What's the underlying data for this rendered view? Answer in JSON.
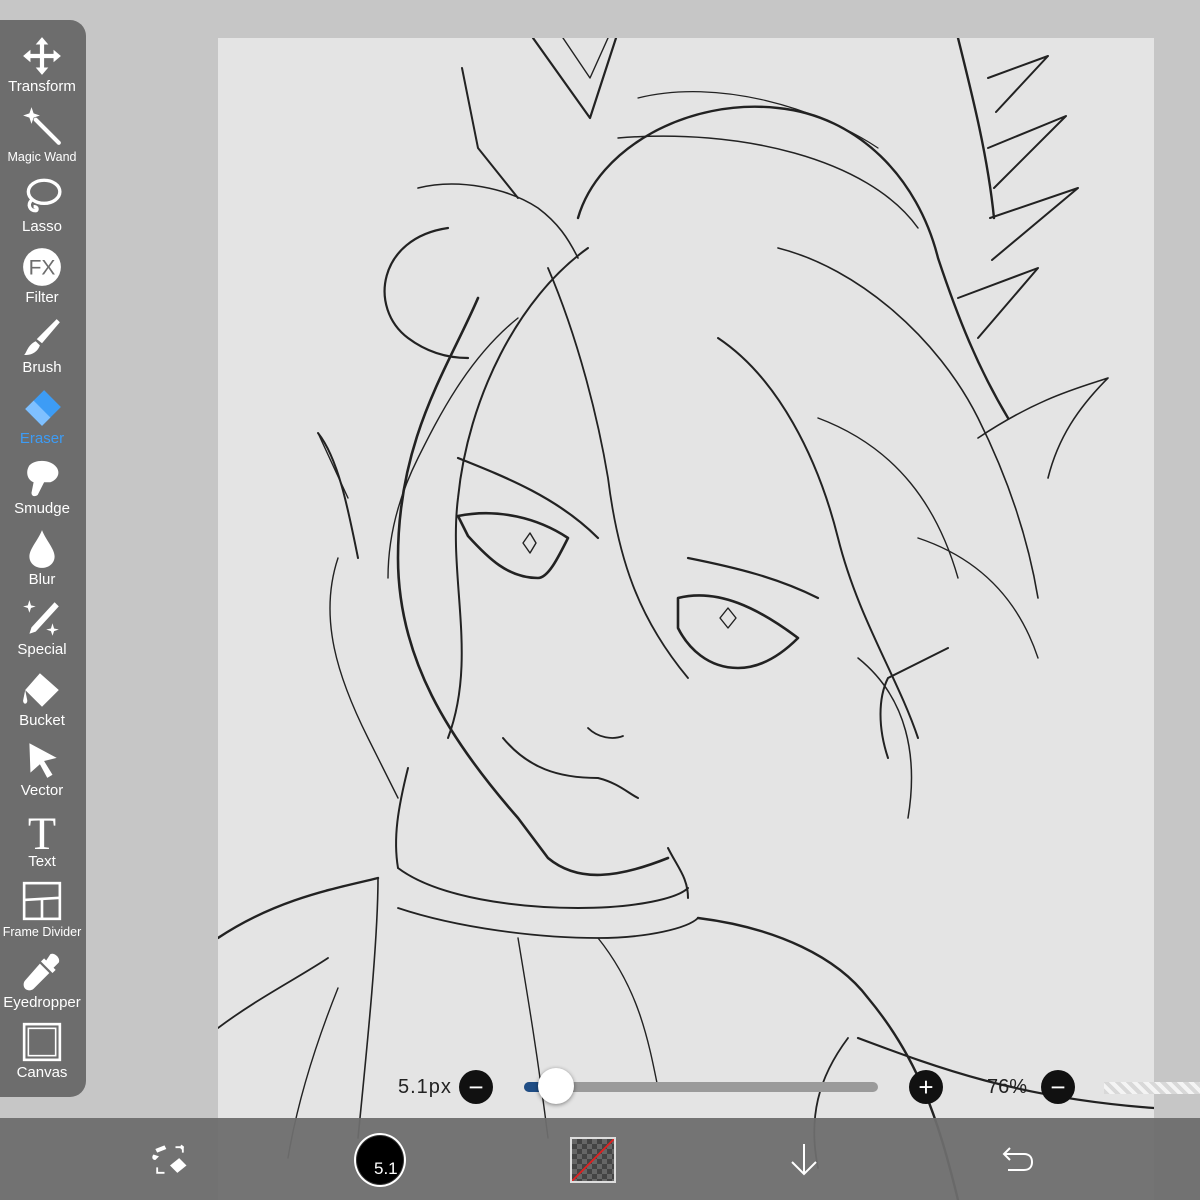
{
  "toolbar": {
    "tools": [
      {
        "label": "Transform",
        "icon": "move-arrows-icon"
      },
      {
        "label": "Magic Wand",
        "icon": "magic-wand-icon"
      },
      {
        "label": "Lasso",
        "icon": "lasso-icon"
      },
      {
        "label": "Filter",
        "icon": "fx-filter-icon",
        "glyph": "FX"
      },
      {
        "label": "Brush",
        "icon": "brush-icon"
      },
      {
        "label": "Eraser",
        "icon": "eraser-icon",
        "active": true
      },
      {
        "label": "Smudge",
        "icon": "smudge-finger-icon"
      },
      {
        "label": "Blur",
        "icon": "drop-icon"
      },
      {
        "label": "Special",
        "icon": "sparkle-pen-icon"
      },
      {
        "label": "Bucket",
        "icon": "bucket-icon"
      },
      {
        "label": "Vector",
        "icon": "cursor-arrow-icon"
      },
      {
        "label": "Text",
        "icon": "text-t-icon",
        "glyph": "T"
      },
      {
        "label": "Frame Divider",
        "icon": "frame-divider-icon"
      },
      {
        "label": "Eyedropper",
        "icon": "eyedropper-icon"
      },
      {
        "label": "Canvas",
        "icon": "canvas-square-icon"
      }
    ],
    "active_color": "#3d9cf5"
  },
  "brush_size": {
    "size_label": "5.1px",
    "minus": "−",
    "plus": "+",
    "slider_level": 0.09,
    "zoom_label": "76%",
    "zoom_minus": "−"
  },
  "bottom_bar": {
    "brush_size_badge": "5.1",
    "icons": [
      "swap-brush-eraser-icon",
      "brush-preview-icon",
      "color-swatch-icon",
      "down-arrow-icon",
      "undo-icon"
    ]
  }
}
